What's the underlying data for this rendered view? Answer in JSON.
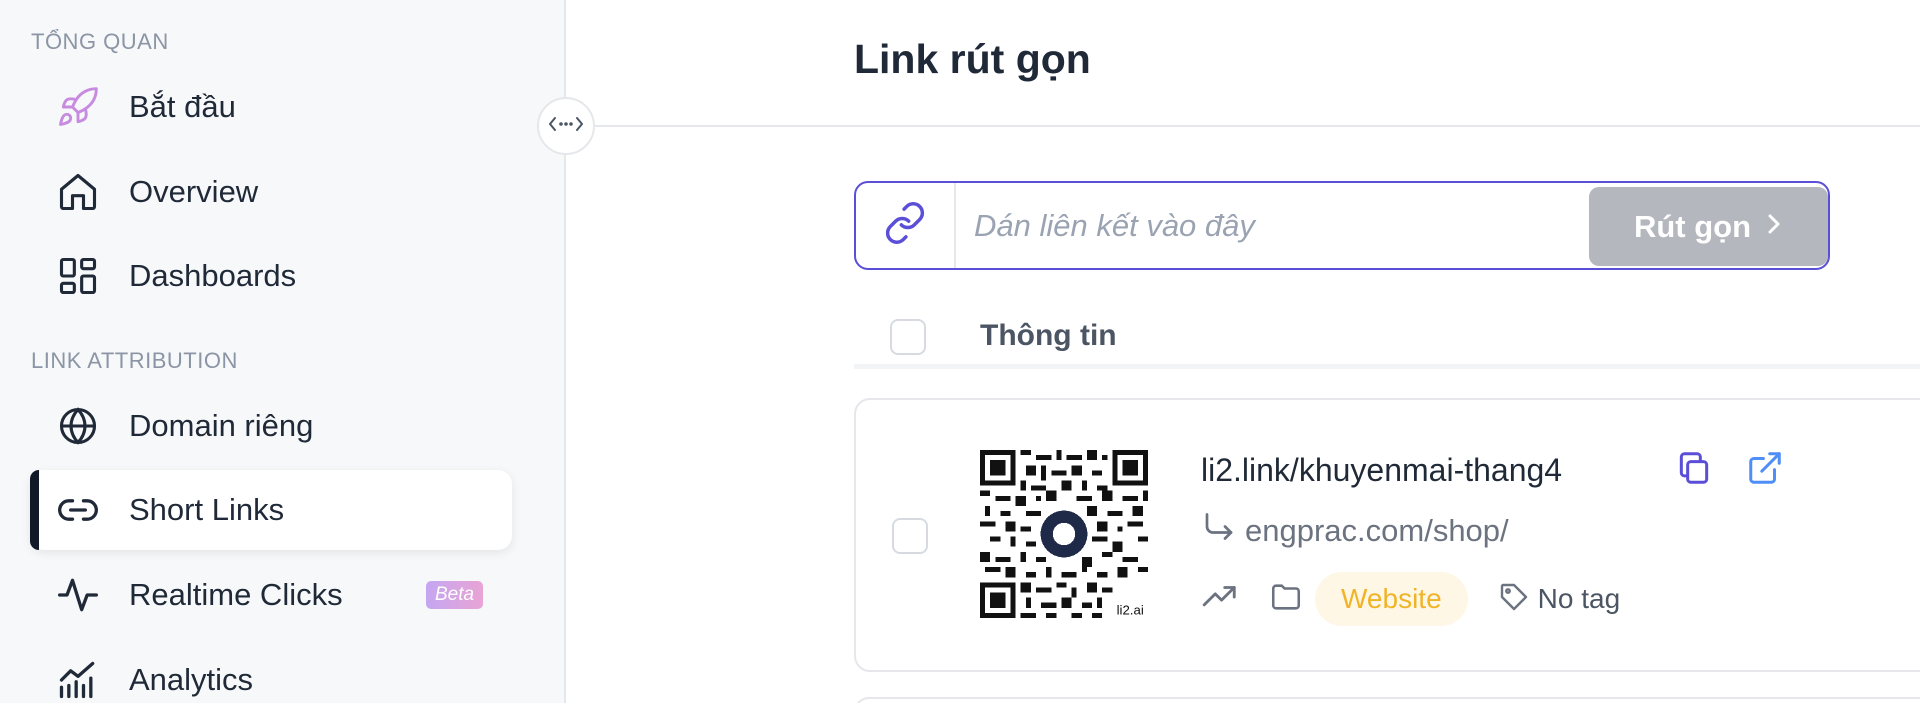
{
  "sidebar": {
    "sections": [
      "Tổng quan",
      "Link attribution"
    ],
    "items": [
      {
        "label": "Bắt đầu",
        "icon": "rocket-icon"
      },
      {
        "label": "Overview",
        "icon": "home-icon"
      },
      {
        "label": "Dashboards",
        "icon": "dashboard-icon"
      },
      {
        "label": "Domain riêng",
        "icon": "globe-icon"
      },
      {
        "label": "Short Links",
        "icon": "link-icon",
        "active": true
      },
      {
        "label": "Realtime Clicks",
        "icon": "activity-icon",
        "badge": "Beta"
      },
      {
        "label": "Analytics",
        "icon": "chart-icon"
      }
    ]
  },
  "main": {
    "title": "Link rút gọn",
    "shortener": {
      "placeholder": "Dán liên kết vào đây",
      "value": "",
      "button_label": "Rút gọn"
    },
    "table": {
      "header": "Thông tin"
    },
    "links": [
      {
        "short_url": "li2.link/khuyenmai-thang4",
        "destination": "engprac.com/shop/",
        "folder": "Website",
        "tag": "No tag",
        "qr_caption": "li2.ai"
      }
    ]
  },
  "colors": {
    "accent": "#5b4fd8",
    "active_bar": "#111827",
    "button_disabled": "#b4b7be",
    "folder_text": "#f0b429",
    "folder_bg": "#fff7e6"
  }
}
